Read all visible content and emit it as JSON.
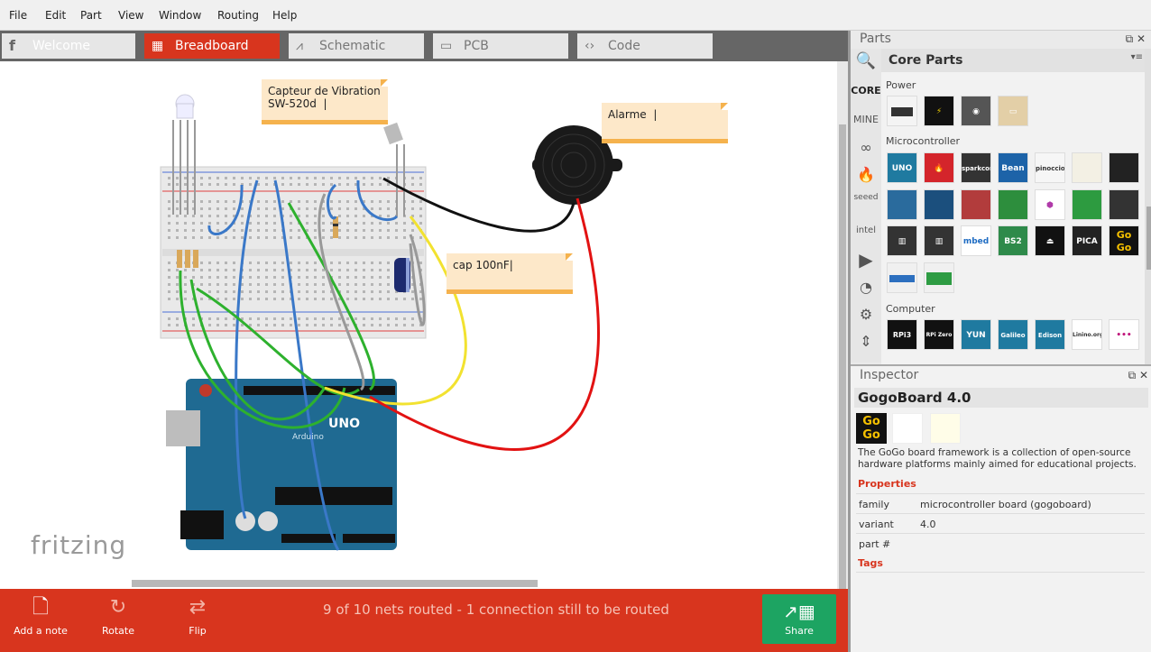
{
  "menu": [
    "File",
    "Edit",
    "Part",
    "View",
    "Window",
    "Routing",
    "Help"
  ],
  "tabs": [
    {
      "label": "Welcome",
      "icon": "fritzing-f-icon"
    },
    {
      "label": "Breadboard",
      "icon": "breadboard-icon"
    },
    {
      "label": "Schematic",
      "icon": "schematic-icon"
    },
    {
      "label": "PCB",
      "icon": "pcb-icon"
    },
    {
      "label": "Code",
      "icon": "code-icon"
    }
  ],
  "canvas": {
    "notes": [
      {
        "text": "Capteur de Vibration\nSW-520d  |"
      },
      {
        "text": "Alarme  |"
      },
      {
        "text": "cap 100nF|"
      }
    ],
    "logo": "fritzing",
    "arduino_label": "UNO",
    "arduino_sub": "Arduino"
  },
  "toolbar": {
    "add_note": "Add a note",
    "rotate": "Rotate",
    "flip": "Flip",
    "status": "9 of 10 nets routed - 1 connection still to be routed",
    "share": "Share"
  },
  "parts": {
    "title": "Parts",
    "bin_title": "Core Parts",
    "bins": [
      "CORE",
      "MINE"
    ],
    "categories": [
      {
        "name": "Power"
      },
      {
        "name": "Microcontroller"
      },
      {
        "name": "Computer"
      }
    ],
    "tile_labels": {
      "uno": "UNO",
      "bean": "Bean",
      "mbed": "mbed",
      "bs2": "BS2",
      "pica": "PICA",
      "gogo": "Go Go",
      "rpi3": "RPi3",
      "rpizero": "RPi Zero",
      "yun": "YUN",
      "galileo": "Galileo",
      "edison": "Edison",
      "pinoccio": "pinoccio",
      "sparkcore": "sparkcore",
      "linino": "Linino.org"
    }
  },
  "inspector": {
    "title": "Inspector",
    "part_name": "GogoBoard 4.0",
    "description": "The GoGo board framework is a collection of open-source hardware platforms mainly aimed for educational projects.",
    "properties_label": "Properties",
    "properties": [
      {
        "key": "family",
        "value": "microcontroller board (gogoboard)"
      },
      {
        "key": "variant",
        "value": "4.0"
      },
      {
        "key": "part #",
        "value": ""
      }
    ],
    "tags_label": "Tags"
  },
  "colors": {
    "accent_red": "#d8351e",
    "share_green": "#1da462",
    "note_bg": "#fde8c9",
    "note_bar": "#f5b24d",
    "arduino_blue": "#1f6a92"
  }
}
